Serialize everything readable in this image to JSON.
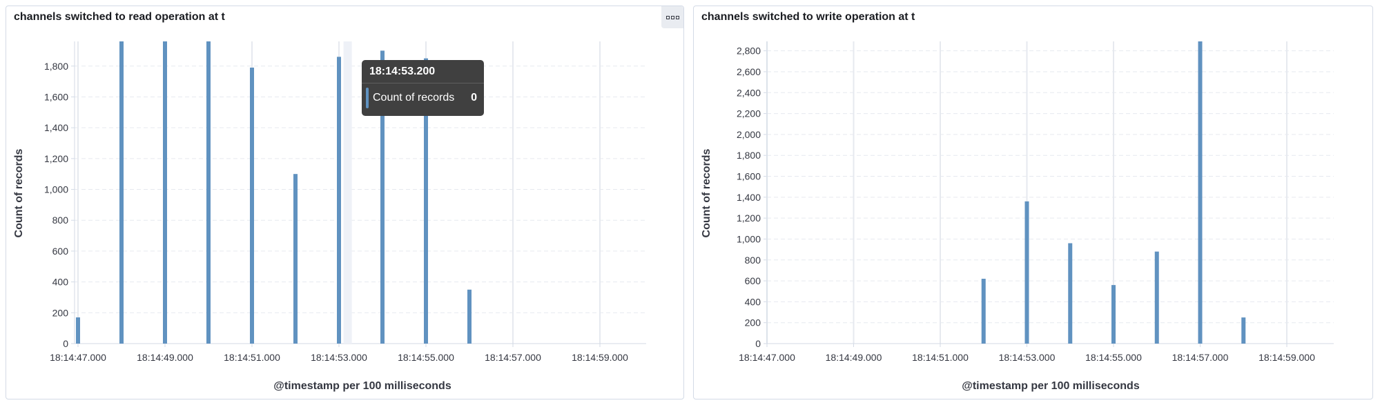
{
  "colors": {
    "bar": "#6092c0",
    "grid": "#e6e9ef",
    "axis": "#d3dae6",
    "text": "#343741",
    "tooltip_bg": "#404040"
  },
  "icons": {
    "panel_menu": "ellipsis-boxes-icon"
  },
  "panels": [
    {
      "title": "channels switched to read operation at t",
      "tooltip": {
        "time": "18:14:53.200",
        "label": "Count of records",
        "value": "0"
      }
    },
    {
      "title": "channels switched to write operation at t"
    }
  ],
  "chart_data": [
    {
      "type": "bar",
      "title": "channels switched to read operation at t",
      "xlabel": "@timestamp per 100 milliseconds",
      "ylabel": "Count of records",
      "x_tick_labels": [
        "18:14:47.000",
        "18:14:49.000",
        "18:14:51.000",
        "18:14:53.000",
        "18:14:55.000",
        "18:14:57.000",
        "18:14:59.000"
      ],
      "y_tick_labels": [
        "0",
        "200",
        "400",
        "600",
        "800",
        "1,000",
        "1,200",
        "1,400",
        "1,600",
        "1,800"
      ],
      "ylim": [
        0,
        1960
      ],
      "grid": true,
      "x": [
        "18:14:47.000",
        "18:14:48.000",
        "18:14:49.000",
        "18:14:50.000",
        "18:14:51.000",
        "18:14:52.000",
        "18:14:53.000",
        "18:14:54.000",
        "18:14:55.000",
        "18:14:56.000"
      ],
      "values": [
        170,
        1960,
        1960,
        1960,
        1790,
        1100,
        1860,
        1900,
        1850,
        350
      ]
    },
    {
      "type": "bar",
      "title": "channels switched to write operation at t",
      "xlabel": "@timestamp per 100 milliseconds",
      "ylabel": "Count of records",
      "x_tick_labels": [
        "18:14:47.000",
        "18:14:49.000",
        "18:14:51.000",
        "18:14:53.000",
        "18:14:55.000",
        "18:14:57.000",
        "18:14:59.000"
      ],
      "y_tick_labels": [
        "0",
        "200",
        "400",
        "600",
        "800",
        "1,000",
        "1,200",
        "1,400",
        "1,600",
        "1,800",
        "2,000",
        "2,200",
        "2,400",
        "2,600",
        "2,800"
      ],
      "ylim": [
        0,
        2890
      ],
      "grid": true,
      "x": [
        "18:14:52.000",
        "18:14:53.000",
        "18:14:54.000",
        "18:14:55.000",
        "18:14:56.000",
        "18:14:57.000",
        "18:14:58.000"
      ],
      "values": [
        620,
        1360,
        960,
        560,
        880,
        2890,
        250
      ]
    }
  ]
}
